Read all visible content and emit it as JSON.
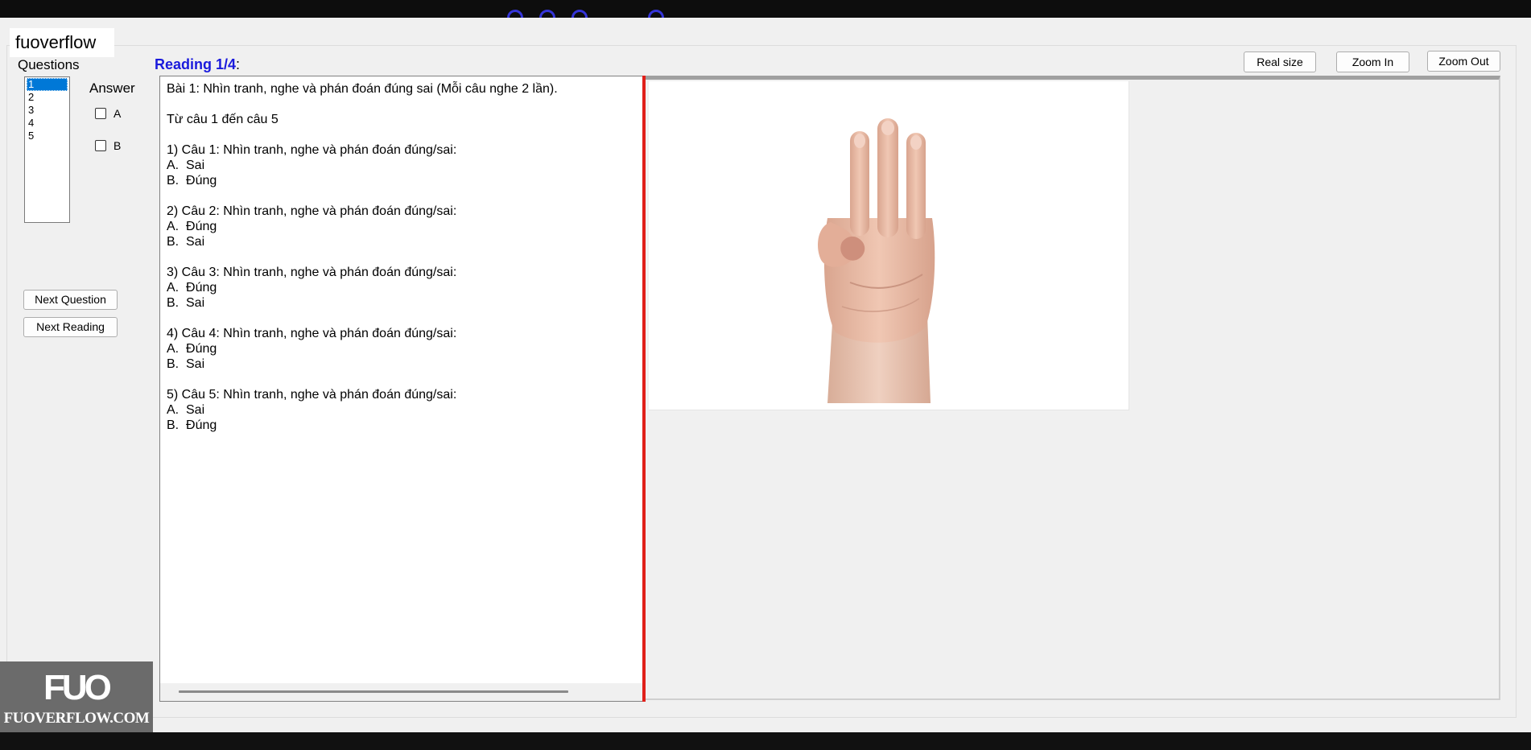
{
  "watermark": {
    "label": "fuoverflow",
    "logo_mark": "FUO",
    "logo_text": "FUOVERFLOW.COM"
  },
  "questions": {
    "label": "Questions",
    "items": [
      "1",
      "2",
      "3",
      "4",
      "5"
    ],
    "selected": "1"
  },
  "answer": {
    "label": "Answer",
    "options": [
      "A",
      "B"
    ]
  },
  "buttons": {
    "next_question": "Next Question",
    "next_reading": "Next Reading",
    "real_size": "Real size",
    "zoom_in": "Zoom In",
    "zoom_out": "Zoom Out"
  },
  "reading": {
    "title": "Reading 1/4",
    "colon": ":",
    "text": "Bài 1: Nhìn tranh, nghe và phán đoán đúng sai (Mỗi câu nghe 2 lần).\n\nTừ câu 1 đến câu 5\n\n1) Câu 1: Nhìn tranh, nghe và phán đoán đúng/sai:\nA.  Sai\nB.  Đúng\n\n2) Câu 2: Nhìn tranh, nghe và phán đoán đúng/sai:\nA.  Đúng\nB.  Sai\n\n3) Câu 3: Nhìn tranh, nghe và phán đoán đúng/sai:\nA.  Đúng\nB.  Sai\n\n4) Câu 4: Nhìn tranh, nghe và phán đoán đúng/sai:\nA.  Đúng\nB.  Sai\n\n5) Câu 5: Nhìn tranh, nghe và phán đoán đúng/sai:\nA.  Sai\nB.  Đúng"
  },
  "image": {
    "subject": "hand-three-fingers"
  },
  "colors": {
    "accent_blue": "#1a1adc",
    "selection": "#0078d7",
    "splitter": "#e0201a"
  }
}
